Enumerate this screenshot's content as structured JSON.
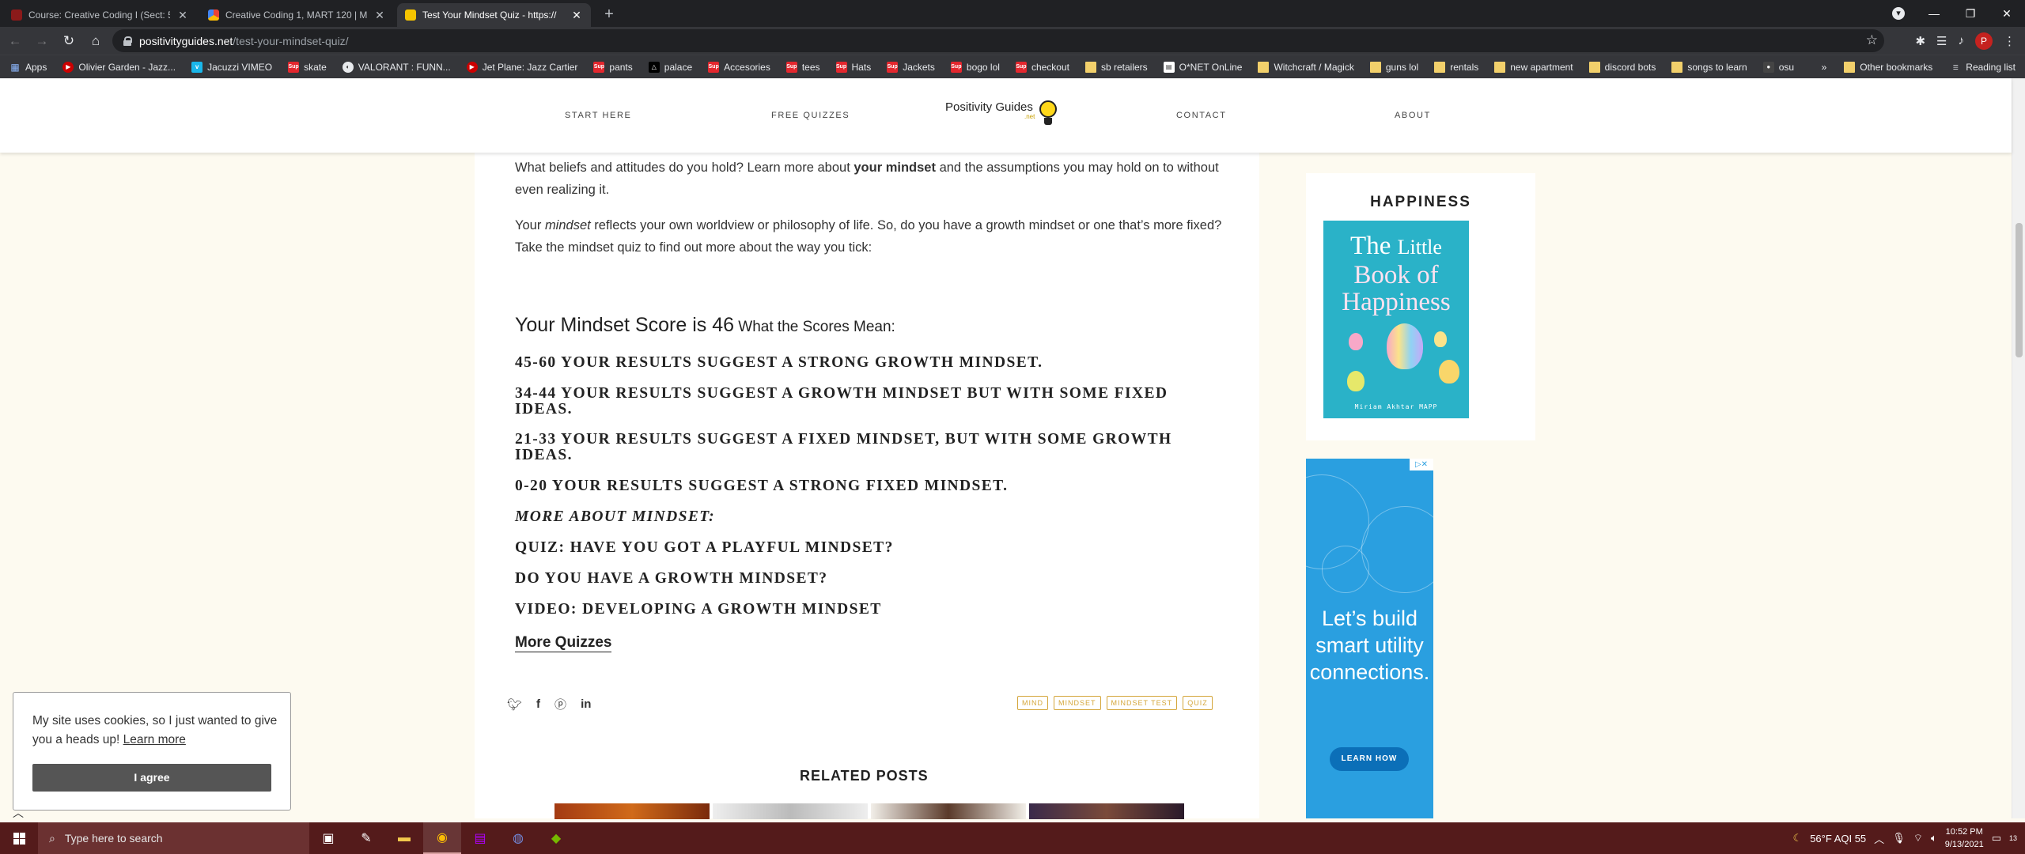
{
  "browser": {
    "tabs": [
      {
        "title": "Course: Creative Coding I (Sect: 5",
        "active": false,
        "favicon_color": "#8b1a1a"
      },
      {
        "title": "Creative Coding 1, MART 120 | M",
        "active": false,
        "favicon_color": "#4285f4"
      },
      {
        "title": "Test Your Mindset Quiz - https://",
        "active": true,
        "favicon_color": "#f5c400"
      }
    ],
    "new_tab": "+",
    "window_controls": {
      "minimize": "—",
      "maximize": "❐",
      "close": "✕"
    },
    "url_host": "positivityguides.net",
    "url_path": "/test-your-mindset-quiz/",
    "profile_initial": "P",
    "bookmarks": [
      {
        "label": "Apps",
        "icon": "apps-grid-icon"
      },
      {
        "label": "Olivier Garden - Jazz...",
        "icon": "youtube-icon"
      },
      {
        "label": "Jacuzzi VIMEO",
        "icon": "vimeo-icon"
      },
      {
        "label": "skate",
        "icon": "supreme-icon"
      },
      {
        "label": "VALORANT : FUNN...",
        "icon": "globe-icon"
      },
      {
        "label": "Jet Plane: Jazz Cartier",
        "icon": "youtube-icon"
      },
      {
        "label": "pants",
        "icon": "supreme-icon"
      },
      {
        "label": "palace",
        "icon": "palace-icon"
      },
      {
        "label": "Accesories",
        "icon": "supreme-icon"
      },
      {
        "label": "tees",
        "icon": "supreme-icon"
      },
      {
        "label": "Hats",
        "icon": "supreme-icon"
      },
      {
        "label": "Jackets",
        "icon": "supreme-icon"
      },
      {
        "label": "bogo lol",
        "icon": "supreme-icon"
      },
      {
        "label": "checkout",
        "icon": "supreme-icon"
      },
      {
        "label": "sb retailers",
        "icon": "folder-icon"
      },
      {
        "label": "O*NET OnLine",
        "icon": "onet-icon"
      },
      {
        "label": "Witchcraft / Magick",
        "icon": "folder-icon"
      },
      {
        "label": "guns lol",
        "icon": "folder-icon"
      },
      {
        "label": "rentals",
        "icon": "folder-icon"
      },
      {
        "label": "new apartment",
        "icon": "folder-icon"
      },
      {
        "label": "discord bots",
        "icon": "folder-icon"
      },
      {
        "label": "songs to learn",
        "icon": "folder-icon"
      },
      {
        "label": "osu",
        "icon": "osu-icon"
      }
    ],
    "bookmarks_more": "»",
    "other_bookmarks": "Other bookmarks",
    "reading_list": "Reading list"
  },
  "site": {
    "nav": {
      "start": "START HERE",
      "quizzes": "FREE QUIZZES",
      "contact": "CONTACT",
      "about": "ABOUT"
    },
    "logo_name": "Positivity Guides",
    "logo_sub": ".net"
  },
  "article": {
    "intro_a": "What beliefs and attitudes do you hold? Learn more about ",
    "intro_bold": "your mindset",
    "intro_b": " and the assumptions you may hold on to without even realizing it.",
    "para2_a": "Your ",
    "para2_em": "mindset",
    "para2_b": " reflects your own worldview or philosophy of life. So, do you have a growth mindset or one that’s more fixed? Take the mindset quiz to find out more about the way you tick:",
    "score_label": "Your Mindset Score is ",
    "score_value": "46",
    "scores_mean": " What the Scores Mean:",
    "results": [
      "45-60 Your results suggest a strong growth mindset.",
      "34-44 Your results suggest a growth mindset but with some fixed ideas.",
      "21-33 Your results suggest a fixed mindset, but with some growth ideas.",
      "0-20 Your results suggest a strong fixed mindset."
    ],
    "more_about": "More About Mindset:",
    "links": [
      "Quiz: Have You Got A Playful Mindset?",
      "Do You Have A Growth Mindset?",
      "Video: Developing A Growth Mindset"
    ],
    "more_quizzes": "More Quizzes",
    "tags": [
      "MIND",
      "MINDSET",
      "MINDSET TEST",
      "QUIZ"
    ],
    "related_title": "RELATED POSTS"
  },
  "sidebar": {
    "widget_title": "HAPPINESS",
    "book_line1": "The",
    "book_line1b": "Little",
    "book_line2": "Book of",
    "book_line3": "Happiness",
    "book_author": "Miriam Akhtar MAPP",
    "ad_text": "Let’s build smart utility connections.",
    "ad_button": "LEARN HOW"
  },
  "cookie": {
    "message": "My site uses cookies, so I just wanted to give you a heads up! ",
    "learn_more": "Learn more",
    "agree": "I agree"
  },
  "taskbar": {
    "search_placeholder": "Type here to search",
    "weather": "56°F  AQI 55",
    "time": "10:52 PM",
    "date": "9/13/2021",
    "notifications": "13"
  },
  "colors": {
    "accent_tag": "#d4a63a",
    "page_bg": "#fdfaf0",
    "taskbar": "#541b1b"
  }
}
